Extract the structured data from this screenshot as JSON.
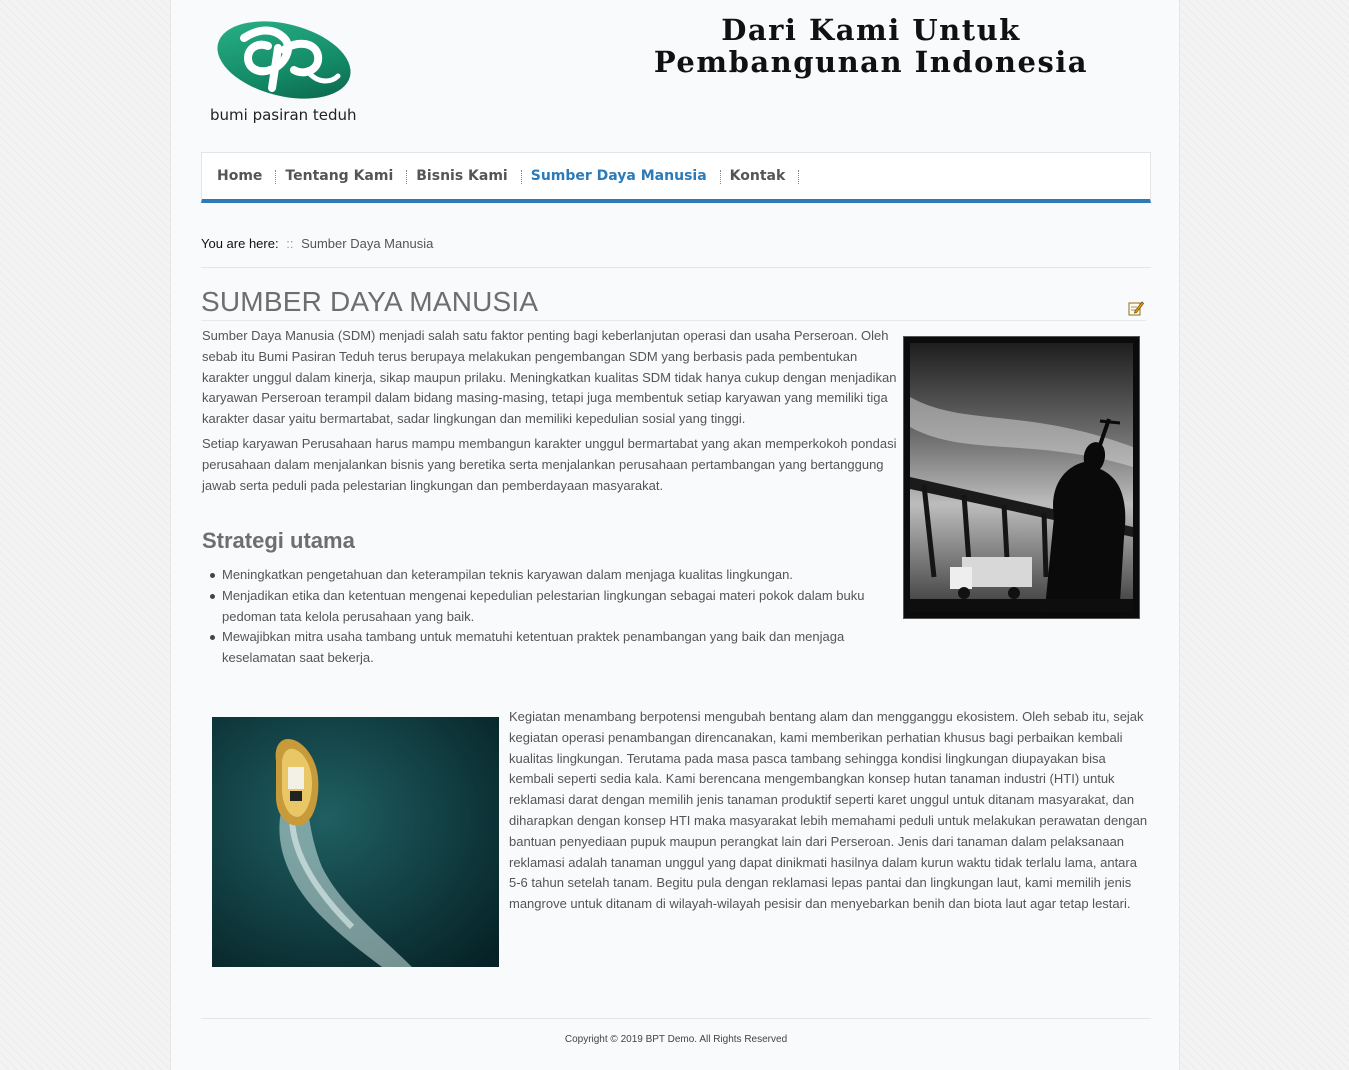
{
  "header": {
    "logo_text": "bumi pasiran teduh",
    "slogan_line1": "Dari Kami Untuk",
    "slogan_line2": "Pembangunan Indonesia"
  },
  "nav": {
    "items": [
      {
        "label": "Home"
      },
      {
        "label": "Tentang Kami"
      },
      {
        "label": "Bisnis Kami"
      },
      {
        "label": "Sumber Daya Manusia"
      },
      {
        "label": "Kontak"
      }
    ],
    "active": "Sumber Daya Manusia"
  },
  "breadcrumb": {
    "lead": "You are here:",
    "separator": "::",
    "current": "Sumber Daya Manusia"
  },
  "article": {
    "title": "SUMBER DAYA MANUSIA",
    "paragraph1": "Sumber Daya Manusia (SDM) menjadi salah satu faktor penting bagi keberlanjutan operasi dan usaha Perseroan. Oleh sebab itu Bumi Pasiran Teduh terus berupaya melakukan pengembangan SDM yang berbasis pada pembentukan karakter unggul dalam kinerja, sikap maupun prilaku. Meningkatkan kualitas SDM tidak hanya cukup dengan menjadikan karyawan Perseroan terampil dalam bidang masing-masing, tetapi juga membentuk setiap karyawan yang memiliki tiga karakter dasar yaitu bermartabat, sadar lingkungan dan memiliki kepedulian sosial yang tinggi.",
    "paragraph2": "Setiap karyawan Perusahaan harus mampu membangun karakter unggul bermartabat yang akan memperkokoh pondasi perusahaan dalam menjalankan bisnis yang beretika serta menjalankan perusahaan pertambangan yang bertanggung jawab serta peduli pada pelestarian lingkungan dan pemberdayaan masyarakat.",
    "strategy_heading": "Strategi utama",
    "strategy_items": [
      "Meningkatkan pengetahuan dan keterampilan teknis karyawan dalam menjaga kualitas lingkungan.",
      "Menjadikan etika dan ketentuan mengenai kepedulian pelestarian lingkungan sebagai materi pokok dalam buku pedoman tata kelola perusahaan yang baik.",
      "Mewajibkan mitra usaha tambang untuk mematuhi ketentuan praktek penambangan yang baik dan menjaga keselamatan saat bekerja."
    ],
    "paragraph3": "Kegiatan menambang berpotensi mengubah bentang alam dan mengganggu ekosistem. Oleh sebab itu, sejak kegiatan operasi penambangan direncanakan, kami memberikan perhatian khusus bagi perbaikan kembali kualitas lingkungan. Terutama pada masa pasca tambang sehingga kondisi lingkungan diupayakan bisa kembali seperti sedia kala. Kami berencana mengembangkan konsep hutan tanaman industri (HTI) untuk reklamasi darat dengan memilih jenis tanaman produktif seperti karet unggul untuk ditanam masyarakat, dan diharapkan dengan konsep HTI maka masyarakat lebih memahami peduli untuk melakukan perawatan dengan bantuan penyediaan pupuk maupun perangkat lain dari Perseroan. Jenis dari tanaman dalam pelaksanaan reklamasi adalah tanaman unggul yang dapat dinikmati hasilnya dalam kurun waktu tidak terlalu lama, antara 5-6 tahun setelah tanam. Begitu pula dengan reklamasi lepas pantai dan lingkungan laut, kami memilih jenis mangrove untuk ditanam di wilayah-wilayah pesisir dan menyebarkan benih dan biota laut agar tetap lestari."
  },
  "footer": {
    "copyright": "Copyright © 2019 BPT Demo. All Rights Reserved"
  },
  "colors": {
    "accent": "#2d7ab8",
    "logo_green": "#1a8a6a",
    "heading_gray": "#6e6e6e"
  },
  "icons": {
    "edit": "edit-icon"
  }
}
